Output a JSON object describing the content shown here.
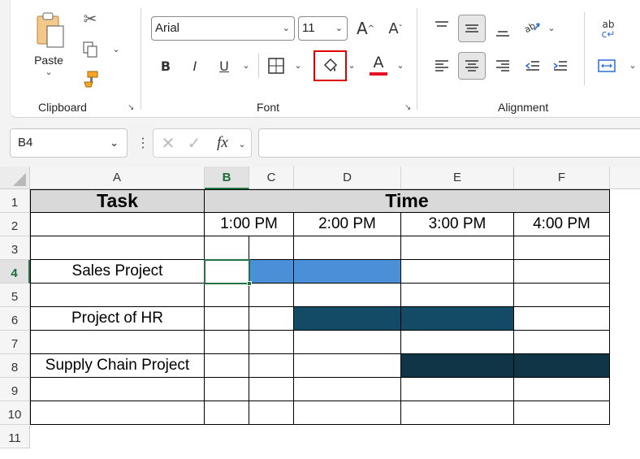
{
  "ribbon": {
    "clipboard": {
      "label": "Clipboard",
      "paste_label": "Paste"
    },
    "font": {
      "label": "Font",
      "font_name": "Arial",
      "font_size": "11"
    },
    "alignment": {
      "label": "Alignment"
    },
    "icons": [
      "paste-icon",
      "cut-icon",
      "copy-icon",
      "format-painter-icon",
      "bold-icon",
      "italic-icon",
      "underline-icon",
      "borders-icon",
      "fill-color-icon",
      "font-color-icon",
      "increase-font-icon",
      "decrease-font-icon",
      "align-top-icon",
      "align-middle-icon",
      "align-bottom-icon",
      "orientation-icon",
      "align-left-icon",
      "align-center-icon",
      "align-right-icon",
      "decrease-indent-icon",
      "increase-indent-icon",
      "wrap-text-icon",
      "merge-center-icon"
    ],
    "font_color_accent": "#e81123",
    "highlight_border": "#e00000"
  },
  "formula_bar": {
    "name_box": "B4",
    "fx": "fx",
    "formula": ""
  },
  "sheet": {
    "columns": [
      "A",
      "B",
      "C",
      "D",
      "E",
      "F"
    ],
    "rows": [
      "1",
      "2",
      "3",
      "4",
      "5",
      "6",
      "7",
      "8",
      "9",
      "10",
      "11"
    ],
    "header_task": "Task",
    "header_time": "Time",
    "times": [
      "1:00 PM",
      "2:00 PM",
      "3:00 PM",
      "4:00 PM"
    ],
    "tasks": [
      {
        "name": "Sales Project",
        "bar_color": "#4a90d9"
      },
      {
        "name": "Project of HR",
        "bar_color": "#134a66"
      },
      {
        "name": "Supply Chain Project",
        "bar_color": "#0f3547"
      }
    ],
    "active_cell": "B4"
  }
}
